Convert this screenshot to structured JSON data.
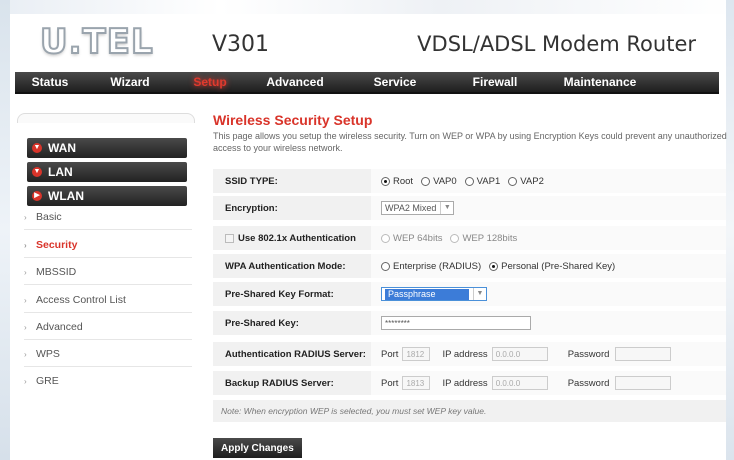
{
  "header": {
    "logo_text": "U.TEL",
    "model": "V301",
    "product": "VDSL/ADSL Modem Router"
  },
  "nav": {
    "items": [
      {
        "label": "Status"
      },
      {
        "label": "Wizard"
      },
      {
        "label": "Setup"
      },
      {
        "label": "Advanced"
      },
      {
        "label": "Service"
      },
      {
        "label": "Firewall"
      },
      {
        "label": "Maintenance"
      }
    ],
    "active": "Setup"
  },
  "sidebar": {
    "main": [
      {
        "label": "WAN"
      },
      {
        "label": "LAN"
      },
      {
        "label": "WLAN"
      }
    ],
    "sub": [
      {
        "label": "Basic"
      },
      {
        "label": "Security"
      },
      {
        "label": "MBSSID"
      },
      {
        "label": "Access Control List"
      },
      {
        "label": "Advanced"
      },
      {
        "label": "WPS"
      },
      {
        "label": "GRE"
      }
    ],
    "active_sub": "Security"
  },
  "content": {
    "title": "Wireless Security Setup",
    "description": "This page allows you setup the wireless security. Turn on WEP or WPA by using Encryption Keys could prevent any unauthorized access to your wireless network.",
    "ssid_type": {
      "label": "SSID TYPE:",
      "options": [
        "Root",
        "VAP0",
        "VAP1",
        "VAP2"
      ],
      "selected": "Root"
    },
    "encryption": {
      "label": "Encryption:",
      "value": "WPA2 Mixed"
    },
    "use_8021x": {
      "label": "Use 802.1x Authentication",
      "options": [
        "WEP 64bits",
        "WEP 128bits"
      ]
    },
    "wpa_auth_mode": {
      "label": "WPA Authentication Mode:",
      "options": [
        "Enterprise (RADIUS)",
        "Personal (Pre-Shared Key)"
      ],
      "selected": "Personal (Pre-Shared Key)"
    },
    "psk_format": {
      "label": "Pre-Shared Key Format:",
      "value": "Passphrase"
    },
    "psk": {
      "label": "Pre-Shared Key:",
      "value": "********"
    },
    "auth_radius": {
      "label": "Authentication RADIUS Server:",
      "port_label": "Port",
      "port": "1812",
      "ip_label": "IP address",
      "ip": "0.0.0.0",
      "password_label": "Password",
      "password": ""
    },
    "backup_radius": {
      "label": "Backup RADIUS Server:",
      "port_label": "Port",
      "port": "1813",
      "ip_label": "IP address",
      "ip": "0.0.0.0",
      "password_label": "Password",
      "password": ""
    },
    "note": "Note: When encryption WEP is selected, you must set WEP key value.",
    "apply_label": "Apply Changes"
  },
  "colors": {
    "accent_red": "#d9342a",
    "nav_dark": "#1e1e1e",
    "selection_blue": "#3c7cd8"
  }
}
